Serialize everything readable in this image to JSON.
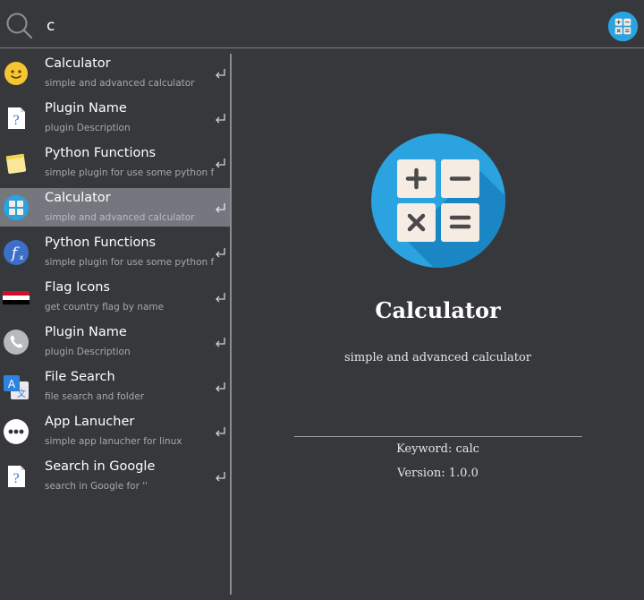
{
  "search": {
    "query": "c",
    "placeholder": ""
  },
  "results": [
    {
      "title": "Calculator",
      "description": "simple and advanced calculator",
      "icon": "smiley-icon"
    },
    {
      "title": "Plugin Name",
      "description": "plugin Description",
      "icon": "question-document-icon"
    },
    {
      "title": "Python Functions",
      "description": "simple plugin for use some python functions",
      "icon": "notepad-icon"
    },
    {
      "title": "Calculator",
      "description": "simple and advanced calculator",
      "icon": "calculator-icon",
      "selected": true
    },
    {
      "title": "Python Functions",
      "description": "simple plugin for use some python functions",
      "icon": "function-icon"
    },
    {
      "title": "Flag Icons",
      "description": "get country flag by name",
      "icon": "flag-icon"
    },
    {
      "title": "Plugin Name",
      "description": "plugin Description",
      "icon": "phone-icon"
    },
    {
      "title": "File Search",
      "description": "file search and folder",
      "icon": "translate-icon"
    },
    {
      "title": "App Lanucher",
      "description": "simple app lanucher for linux",
      "icon": "more-dots-icon"
    },
    {
      "title": "Search in Google",
      "description": "search in Google for ''",
      "icon": "question-document-icon"
    }
  ],
  "detail": {
    "title": "Calculator",
    "description": "simple and advanced calculator",
    "keyword": "Keyword: calc",
    "version": "Version: 1.0.0",
    "icon": "calculator-icon"
  },
  "colors": {
    "background": "#36383c",
    "selected_row": "#74787e",
    "calculator_blue": "#2aa3e0"
  }
}
